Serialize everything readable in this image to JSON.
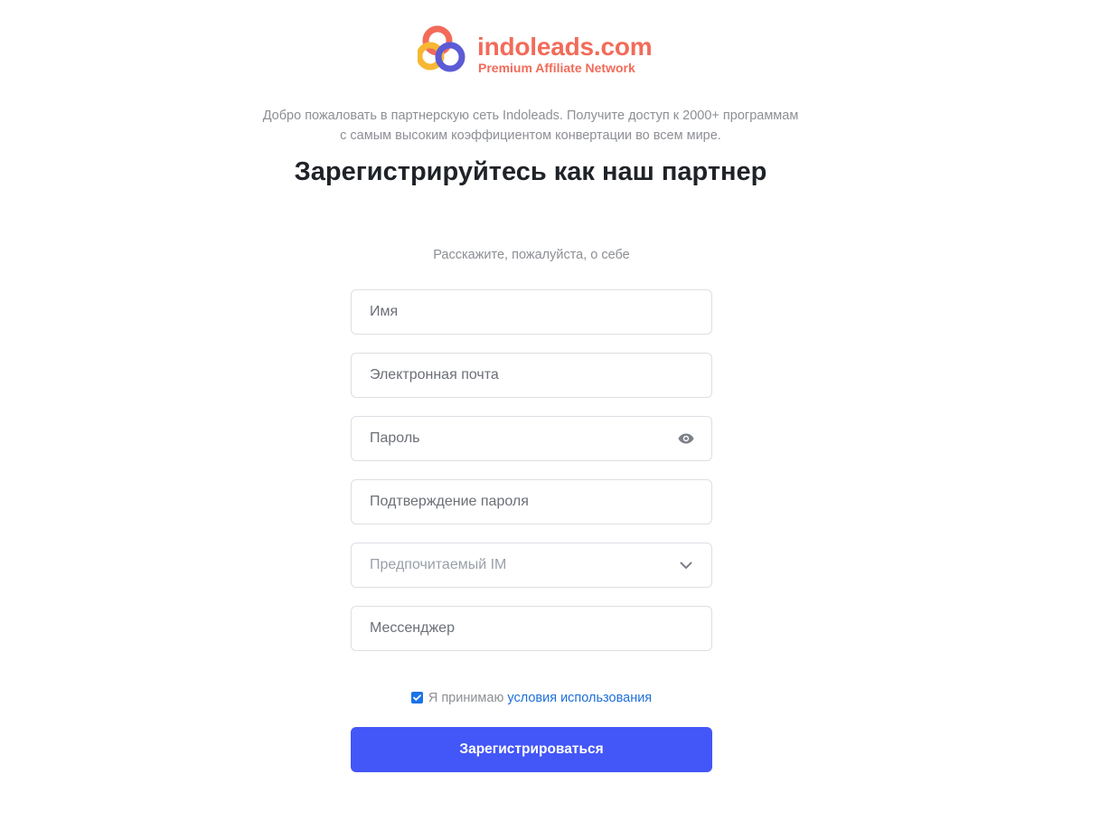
{
  "brand": {
    "name": "indoleads.com",
    "tagline": "Premium Affiliate Network",
    "logo_icon": "indoleads-logo-icon",
    "color": "#f26b5a"
  },
  "intro": {
    "line1": "Добро пожаловать в партнерскую сеть Indoleads. Получите доступ к 2000+ программам",
    "line2": "с самым высоким коэффициентом конвертации во всем мире."
  },
  "title": "Зарегистрируйтесь как наш партнер",
  "subtitle": "Расскажите, пожалуйста, о себе",
  "form": {
    "name": {
      "placeholder": "Имя",
      "value": ""
    },
    "email": {
      "placeholder": "Электронная почта",
      "value": ""
    },
    "password": {
      "placeholder": "Пароль",
      "value": "",
      "icon": "eye-icon"
    },
    "password_confirm": {
      "placeholder": "Подтверждение пароля",
      "value": ""
    },
    "preferred_im": {
      "selected": "Предпочитаемый IM",
      "icon": "chevron-down-icon"
    },
    "messenger": {
      "placeholder": "Мессенджер",
      "value": ""
    }
  },
  "terms": {
    "checked": true,
    "prefix": "Я принимаю",
    "link_label": "условия использования"
  },
  "submit_label": "Зарегистрироваться",
  "colors": {
    "accent": "#4356f7",
    "link": "#1e6fd9",
    "checkbox": "#1a73e8",
    "muted_text": "#8c8f94"
  }
}
